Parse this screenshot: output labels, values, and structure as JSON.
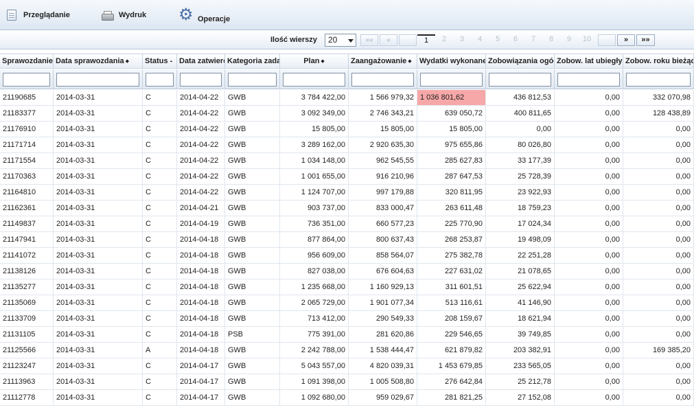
{
  "toolbar": {
    "browse_label": "Przeglądanie",
    "print_label": "Wydruk",
    "operations_label": "Operacje"
  },
  "pager": {
    "rows_label": "Ilość wierszy",
    "rows_value": "20",
    "first": "««",
    "prev": "«",
    "next": "»",
    "last": "»»",
    "pages": [
      "1",
      "2",
      "3",
      "4",
      "5",
      "6",
      "7",
      "8",
      "9",
      "10"
    ],
    "current_page": "1"
  },
  "table": {
    "columns": [
      {
        "label": "Sprawozdanie",
        "sort": ""
      },
      {
        "label": "Data sprawozdania",
        "sort": "◆"
      },
      {
        "label": "Status -",
        "sort": ""
      },
      {
        "label": "Data zatwierdzenia",
        "sort": ""
      },
      {
        "label": "Kategoria zadania",
        "sort": ""
      },
      {
        "label": "Plan",
        "sort": "◆"
      },
      {
        "label": "Zaangażowanie",
        "sort": "◆"
      },
      {
        "label": "Wydatki wykonane",
        "sort": ""
      },
      {
        "label": "Zobowiązania ogółem",
        "sort": ""
      },
      {
        "label": "Zobow. lat ubiegłych",
        "sort": ""
      },
      {
        "label": "Zobow. roku bieżącego",
        "sort": ""
      }
    ],
    "rows": [
      [
        "21190685",
        "2014-03-31",
        "C",
        "2014-04-22",
        "GWB",
        "3 784 422,00",
        "1 566 979,32",
        "1 036 801,62",
        "436 812,53",
        "0,00",
        "332 070,98"
      ],
      [
        "21183377",
        "2014-03-31",
        "C",
        "2014-04-22",
        "GWB",
        "3 092 349,00",
        "2 746 343,21",
        "639 050,72",
        "400 811,65",
        "0,00",
        "128 438,89"
      ],
      [
        "21176910",
        "2014-03-31",
        "C",
        "2014-04-22",
        "GWB",
        "15 805,00",
        "15 805,00",
        "15 805,00",
        "0,00",
        "0,00",
        "0,00"
      ],
      [
        "21171714",
        "2014-03-31",
        "C",
        "2014-04-22",
        "GWB",
        "3 289 162,00",
        "2 920 635,30",
        "975 655,86",
        "80 026,80",
        "0,00",
        "0,00"
      ],
      [
        "21171554",
        "2014-03-31",
        "C",
        "2014-04-22",
        "GWB",
        "1 034 148,00",
        "962 545,55",
        "285 627,83",
        "33 177,39",
        "0,00",
        "0,00"
      ],
      [
        "21170363",
        "2014-03-31",
        "C",
        "2014-04-22",
        "GWB",
        "1 001 655,00",
        "916 210,96",
        "287 647,53",
        "25 728,39",
        "0,00",
        "0,00"
      ],
      [
        "21164810",
        "2014-03-31",
        "C",
        "2014-04-22",
        "GWB",
        "1 124 707,00",
        "997 179,88",
        "320 811,95",
        "23 922,93",
        "0,00",
        "0,00"
      ],
      [
        "21162361",
        "2014-03-31",
        "C",
        "2014-04-21",
        "GWB",
        "903 737,00",
        "833 000,47",
        "263 611,48",
        "18 759,23",
        "0,00",
        "0,00"
      ],
      [
        "21149837",
        "2014-03-31",
        "C",
        "2014-04-19",
        "GWB",
        "736 351,00",
        "660 577,23",
        "225 770,90",
        "17 024,34",
        "0,00",
        "0,00"
      ],
      [
        "21147941",
        "2014-03-31",
        "C",
        "2014-04-18",
        "GWB",
        "877 864,00",
        "800 637,43",
        "268 253,87",
        "19 498,09",
        "0,00",
        "0,00"
      ],
      [
        "21141072",
        "2014-03-31",
        "C",
        "2014-04-18",
        "GWB",
        "956 609,00",
        "858 564,07",
        "275 382,78",
        "22 251,28",
        "0,00",
        "0,00"
      ],
      [
        "21138126",
        "2014-03-31",
        "C",
        "2014-04-18",
        "GWB",
        "827 038,00",
        "676 604,63",
        "227 631,02",
        "21 078,65",
        "0,00",
        "0,00"
      ],
      [
        "21135277",
        "2014-03-31",
        "C",
        "2014-04-18",
        "GWB",
        "1 235 668,00",
        "1 160 929,13",
        "311 601,51",
        "25 622,94",
        "0,00",
        "0,00"
      ],
      [
        "21135069",
        "2014-03-31",
        "C",
        "2014-04-18",
        "GWB",
        "2 065 729,00",
        "1 901 077,34",
        "513 116,61",
        "41 146,90",
        "0,00",
        "0,00"
      ],
      [
        "21133709",
        "2014-03-31",
        "C",
        "2014-04-18",
        "GWB",
        "713 412,00",
        "290 549,33",
        "208 159,67",
        "18 621,94",
        "0,00",
        "0,00"
      ],
      [
        "21131105",
        "2014-03-31",
        "C",
        "2014-04-18",
        "PSB",
        "775 391,00",
        "281 620,86",
        "229 546,65",
        "39 749,85",
        "0,00",
        "0,00"
      ],
      [
        "21125566",
        "2014-03-31",
        "A",
        "2014-04-18",
        "GWB",
        "2 242 788,00",
        "1 538 444,47",
        "621 879,82",
        "203 382,91",
        "0,00",
        "169 385,20"
      ],
      [
        "21123247",
        "2014-03-31",
        "C",
        "2014-04-17",
        "GWB",
        "5 043 557,00",
        "4 820 039,31",
        "1 453 679,85",
        "233 565,05",
        "0,00",
        "0,00"
      ],
      [
        "21113963",
        "2014-03-31",
        "C",
        "2014-04-17",
        "GWB",
        "1 091 398,00",
        "1 005 508,80",
        "276 642,84",
        "25 212,78",
        "0,00",
        "0,00"
      ],
      [
        "21112778",
        "2014-03-31",
        "C",
        "2014-04-17",
        "GWB",
        "1 092 680,00",
        "959 029,67",
        "281 821,25",
        "27 152,08",
        "0,00",
        "0,00"
      ]
    ],
    "highlight_cell": {
      "row": 0,
      "col": 7,
      "color": "#f6a7a7"
    }
  }
}
